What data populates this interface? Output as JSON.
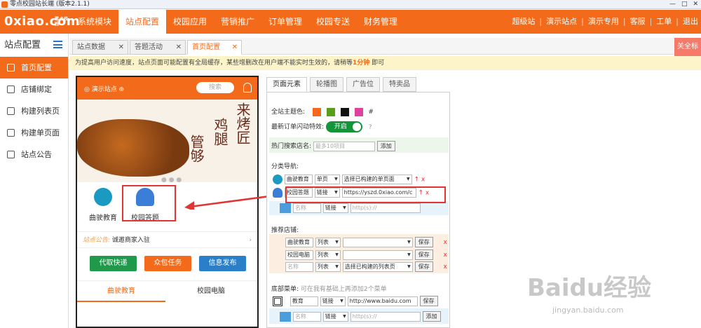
{
  "window": {
    "title": "零点校园站长端 (版本2.1.1)",
    "controls": [
      "—",
      "□",
      "✕"
    ]
  },
  "topnav": {
    "logo": "0xiao.com",
    "logo_sub": "零点校园",
    "items": [
      "系统模块",
      "站点配置",
      "校园应用",
      "营销推广",
      "订单管理",
      "校园专送",
      "财务管理"
    ],
    "active_index": 1,
    "right_links": [
      "超级站",
      "演示站点",
      "演示专用",
      "客服",
      "工单",
      "退出"
    ]
  },
  "sidebar": {
    "title": "站点配置",
    "items": [
      "首页配置",
      "店铺绑定",
      "构建列表页",
      "构建单页面",
      "站点公告"
    ],
    "active_index": 0
  },
  "tabs": {
    "items": [
      "站点数据",
      "答题活动",
      "首页配置"
    ],
    "active_index": 2,
    "close_all": "关全标"
  },
  "notice": {
    "text": "为提高用户访问速度，站点页面可能配置有全局缓存，某些增删改在用户端不能实时生效的，请稍等",
    "highlight": "1分钟",
    "tail": "即可"
  },
  "phone": {
    "location": "演示站点",
    "search_placeholder": "搜索",
    "banner_texts": [
      "来烤匠",
      "鸡腿",
      "管够"
    ],
    "categories": [
      {
        "label": "曲驶教育",
        "icon": "shield-icon"
      },
      {
        "label": "校园答题",
        "icon": "user-icon"
      }
    ],
    "announcement_label": "站点公告:",
    "announcement_text": "诚邀商家入驻",
    "buttons": [
      {
        "label": "代取快递",
        "color": "#1e9a4a"
      },
      {
        "label": "众包任务",
        "color": "#f36b1a"
      },
      {
        "label": "信息发布",
        "color": "#2a80c8"
      }
    ],
    "bottom_tabs": [
      "曲驶教育",
      "校园电脑"
    ],
    "bottom_active": 0
  },
  "editor": {
    "tabs": [
      "页面元素",
      "轮播图",
      "广告位",
      "特卖品"
    ],
    "active_tab": 0,
    "theme_label": "全站主题色:",
    "theme_colors": [
      "#f36b1a",
      "#5a9e1e",
      "#111111",
      "#e040a0"
    ],
    "theme_hash": "#",
    "flash_label": "最新订单闪动特效:",
    "flash_toggle": "开启",
    "flash_help": "?",
    "hot_label": "热门搜索店名:",
    "hot_placeholder": "最多10项目",
    "add_label": "添加",
    "nav_label": "分类导航:",
    "nav_rows": [
      {
        "name": "曲驶教育",
        "type": "单页",
        "target": "选择已构建的单页面"
      },
      {
        "name": "校园答题",
        "type": "链接",
        "target": "https://yszd.0xiao.com/c"
      }
    ],
    "nav_new": {
      "name_ph": "名称",
      "type": "链接",
      "url_ph": "http(s)://"
    },
    "rec_label": "推荐店铺:",
    "rec_rows": [
      {
        "name": "曲驶教育",
        "type": "列表",
        "target": "",
        "save": "保存"
      },
      {
        "name": "校园电脑",
        "type": "列表",
        "target": "",
        "save": "保存"
      },
      {
        "name": "名称",
        "type": "列表",
        "target": "选择已构建的列表页",
        "save": "保存",
        "placeholder": true
      }
    ],
    "bottom_label": "底部菜单:",
    "bottom_hint": "可在我有基础上再添加2个菜单",
    "bottom_rows": [
      {
        "name": "教育",
        "type": "链接",
        "url": "http://www.baidu.com",
        "save": "保存"
      }
    ],
    "bottom_new": {
      "name_ph": "名称",
      "type": "链接",
      "url_ph": "http(s)://",
      "add": "添加"
    },
    "up_arrow": "↑",
    "delete_x": "x"
  },
  "watermark": {
    "main": "Baidu经验",
    "sub": "jingyan.baidu.com"
  }
}
